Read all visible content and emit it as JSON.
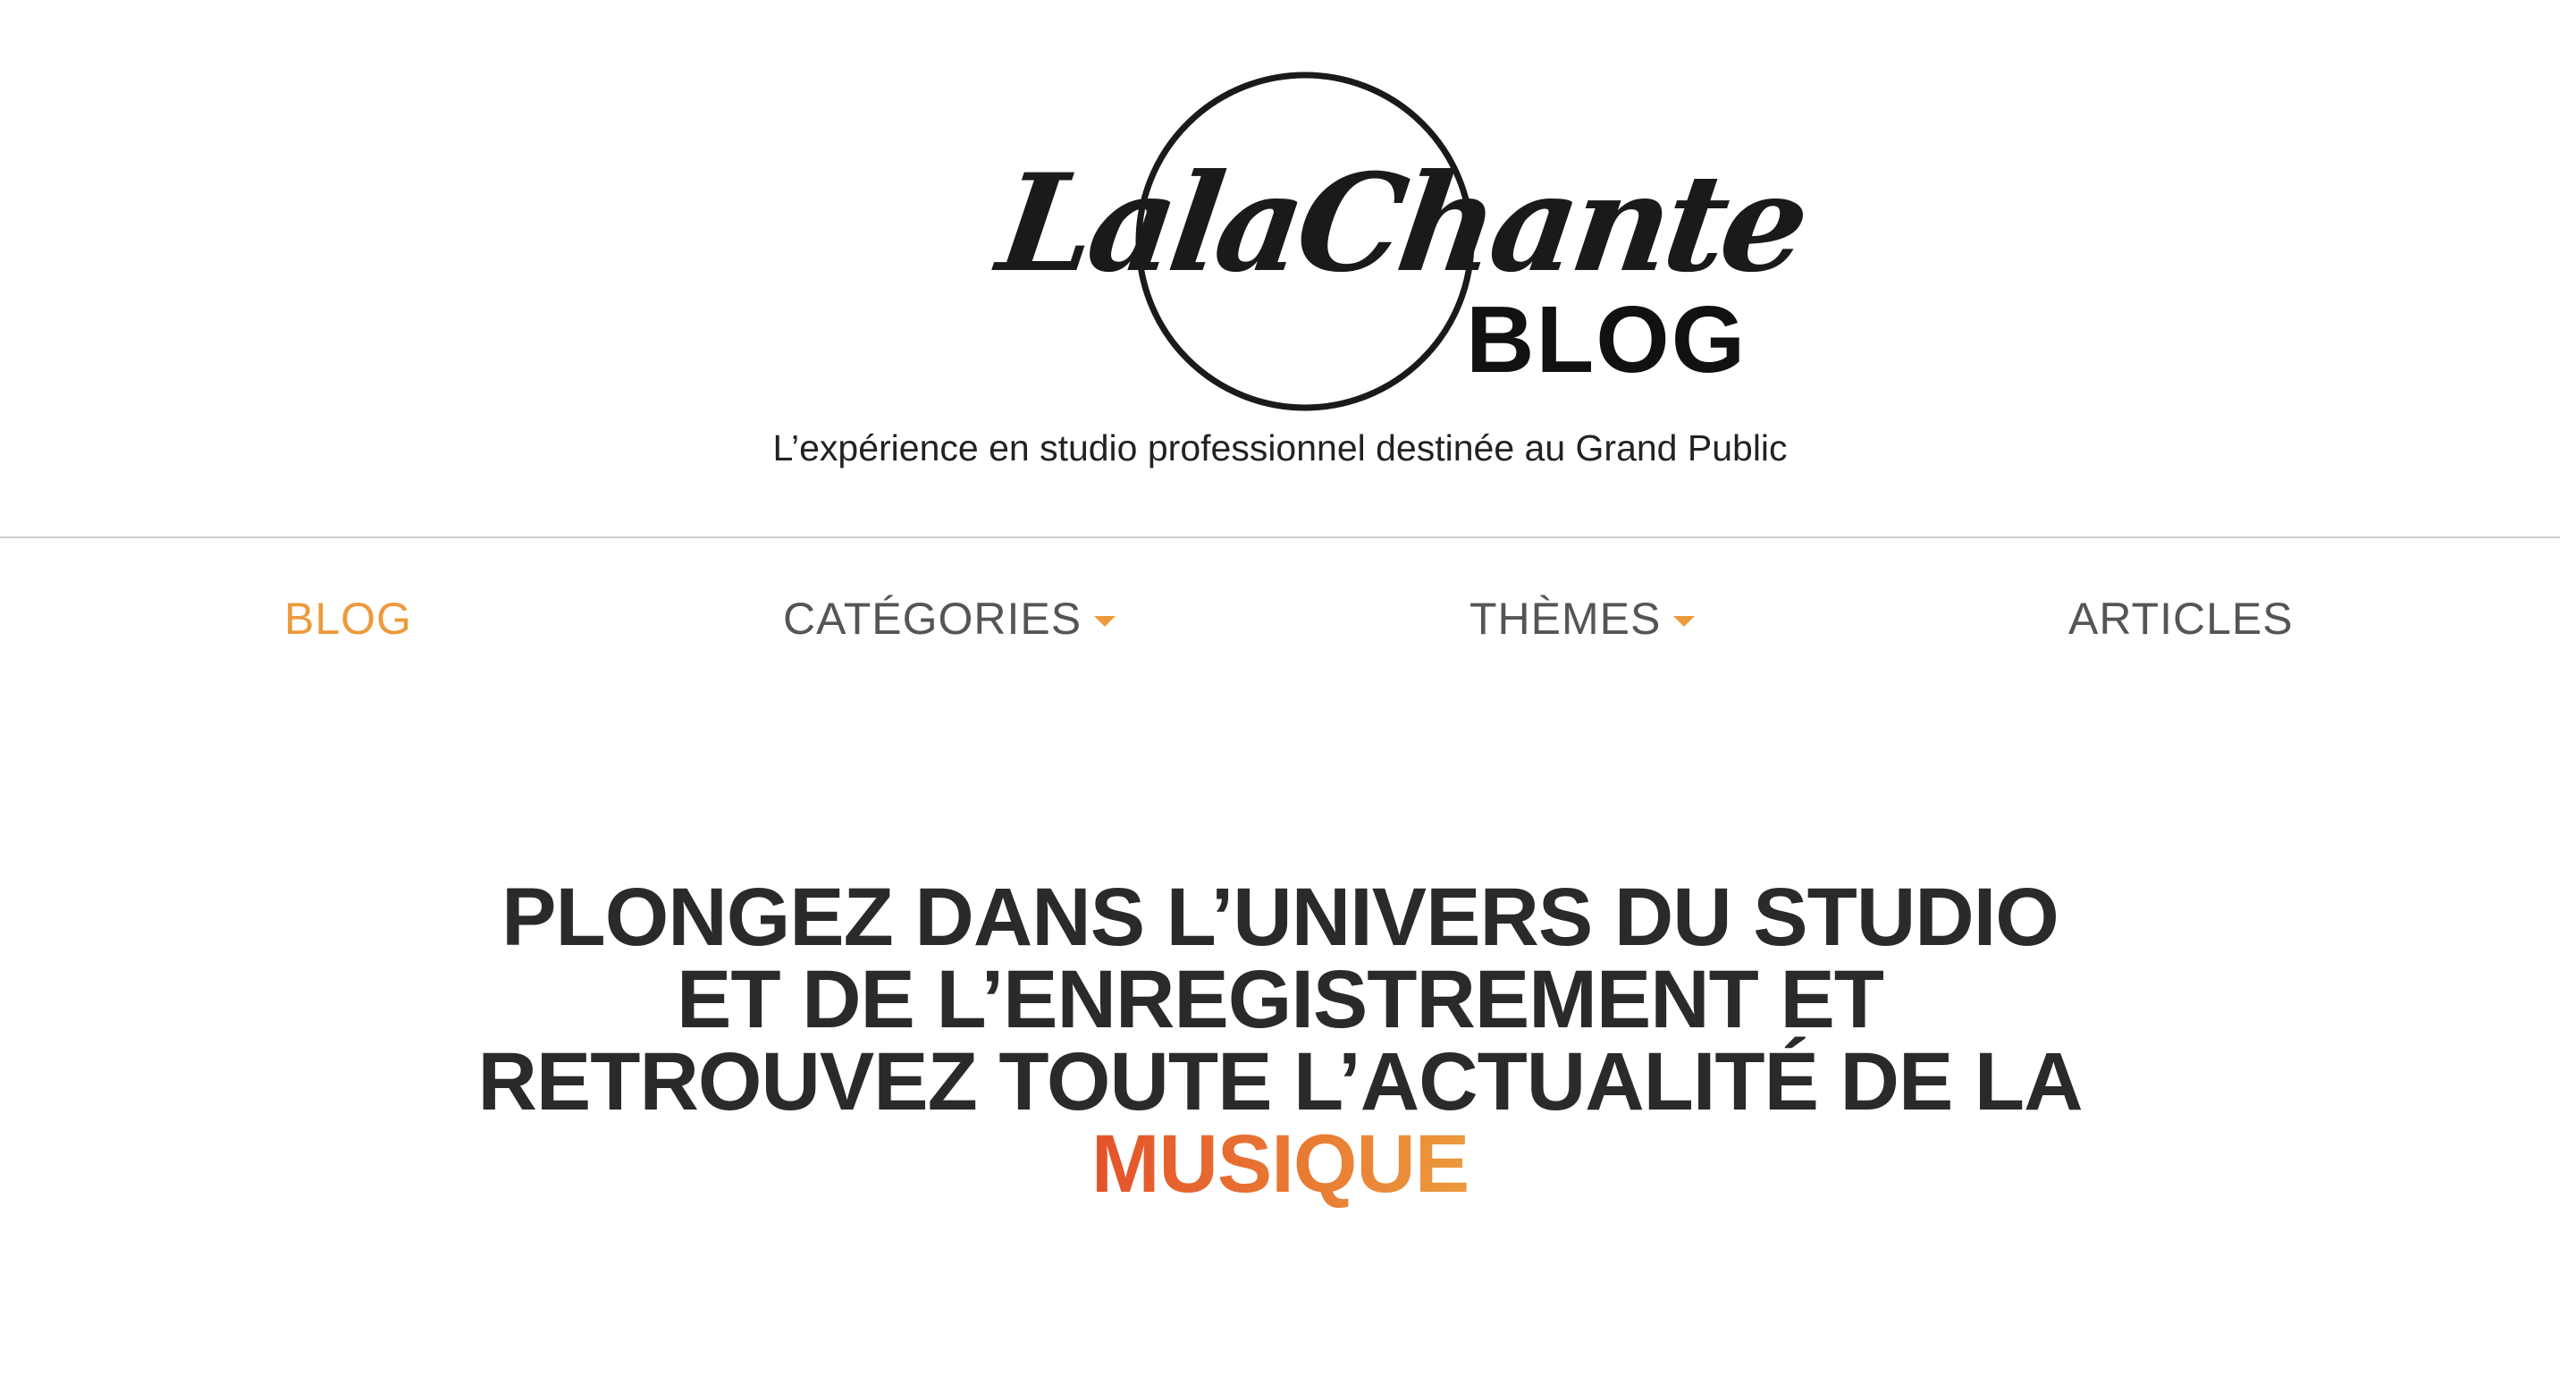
{
  "brand": {
    "logo_script": "LalaChante",
    "logo_suffix": "BLOG",
    "tagline": "L’expérience en studio professionnel destinée au Grand Public"
  },
  "nav": {
    "items": [
      {
        "label": "BLOG",
        "active": true,
        "dropdown": false
      },
      {
        "label": "CATÉGORIES",
        "active": false,
        "dropdown": true
      },
      {
        "label": "THÈMES",
        "active": false,
        "dropdown": true
      },
      {
        "label": "ARTICLES",
        "active": false,
        "dropdown": false
      }
    ]
  },
  "hero": {
    "line1": "PLONGEZ DANS L’UNIVERS DU STUDIO",
    "line2": "ET DE L’ENREGISTREMENT ET",
    "line3": "RETROUVEZ TOUTE L’ACTUALITÉ DE LA",
    "highlight": "MUSIQUE"
  },
  "colors": {
    "accent": "#ec9a3c",
    "accent_gradient_start": "#e4522a",
    "text_dark": "#2a2a2a",
    "nav_text": "#555555",
    "divider": "#cfcfcf",
    "background": "#ffffff"
  },
  "icons": {
    "dropdown": "caret-down-icon"
  }
}
